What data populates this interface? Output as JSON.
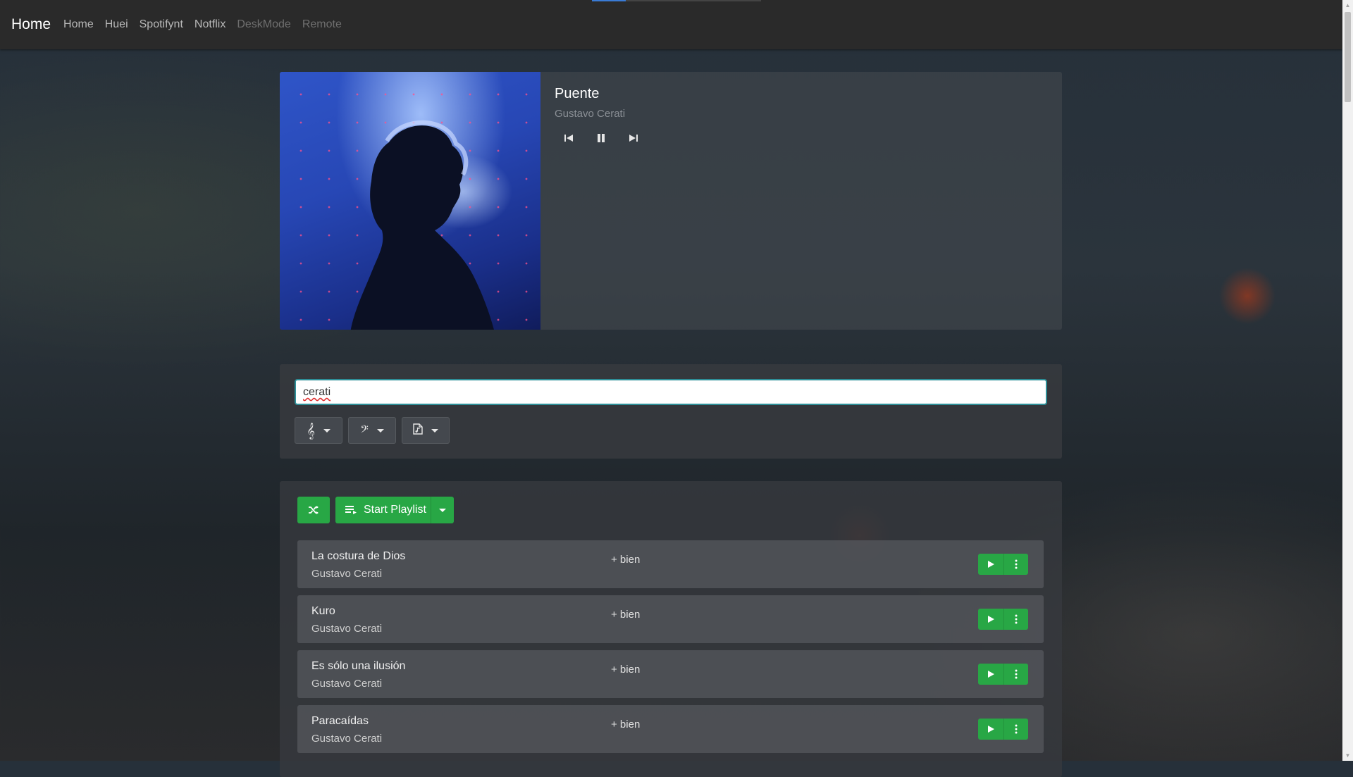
{
  "nav": {
    "brand": "Home",
    "links": [
      {
        "label": "Home",
        "disabled": false
      },
      {
        "label": "Huei",
        "disabled": false
      },
      {
        "label": "Spotifynt",
        "disabled": false
      },
      {
        "label": "Notflix",
        "disabled": false
      },
      {
        "label": "DeskMode",
        "disabled": true
      },
      {
        "label": "Remote",
        "disabled": true
      }
    ]
  },
  "now_playing": {
    "title": "Puente",
    "artist": "Gustavo Cerati",
    "controls": [
      "skip-previous-icon",
      "pause-icon",
      "skip-next-icon"
    ]
  },
  "search": {
    "value": "cerati",
    "filters": [
      "treble-clef-icon",
      "bass-clef-icon",
      "music-file-icon"
    ]
  },
  "playlist": {
    "shuffle_icon": "shuffle-icon",
    "start_label": "Start Playlist"
  },
  "tracks": [
    {
      "title": "La costura de Dios",
      "artist": "Gustavo Cerati",
      "tag": "+ bien"
    },
    {
      "title": "Kuro",
      "artist": "Gustavo Cerati",
      "tag": "+ bien"
    },
    {
      "title": "Es sólo una ilusión",
      "artist": "Gustavo Cerati",
      "tag": "+ bien"
    },
    {
      "title": "Paracaídas",
      "artist": "Gustavo Cerati",
      "tag": "+ bien"
    }
  ],
  "colors": {
    "accent_green": "#28a745",
    "navbar": "#2a2a2a",
    "input_focus": "#2e8f98"
  }
}
